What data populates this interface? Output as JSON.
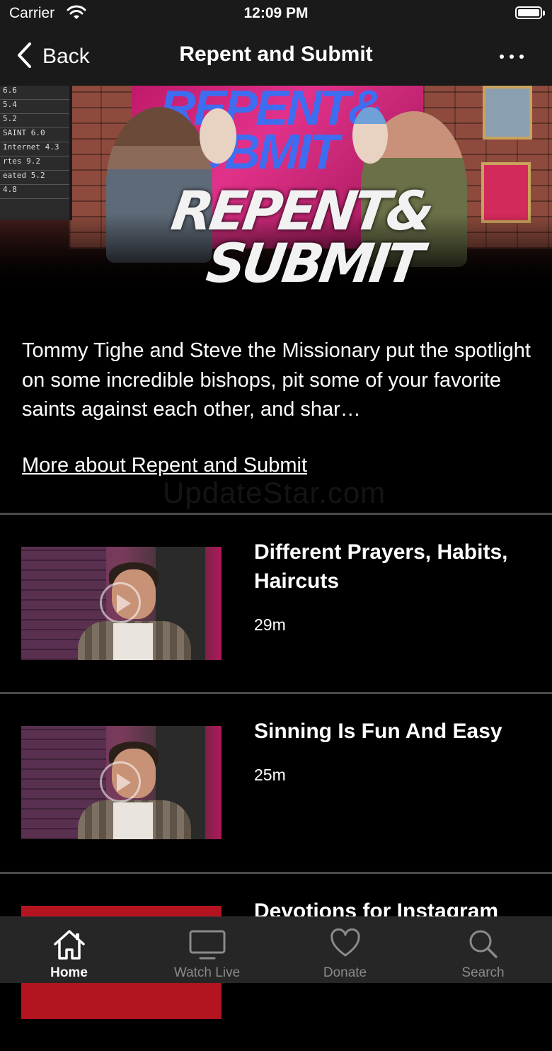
{
  "status_bar": {
    "carrier": "Carrier",
    "time": "12:09 PM"
  },
  "nav": {
    "back_label": "Back",
    "title": "Repent and Submit"
  },
  "hero": {
    "board_rows": [
      "6.6",
      "5.4",
      "5.2",
      "SAINT 6.0",
      "Internet 4.3",
      "rtes 9.2",
      "eated 5.2",
      "4.8"
    ],
    "screen_text_line1": "REPENT&",
    "screen_text_line2": "SUBMIT",
    "logo_line1": "REPENT&",
    "logo_line2": "SUBMIT"
  },
  "description": "Tommy Tighe and Steve the Missionary put the spotlight on some incredible bishops, pit some of your favorite saints against each other, and shar…",
  "more_link": "More about Repent and Submit",
  "watermark": "UpdateStar.com",
  "episodes": [
    {
      "title": "Different Prayers, Habits, Haircuts",
      "duration": "29m"
    },
    {
      "title": "Sinning Is Fun And Easy",
      "duration": "25m"
    },
    {
      "title": "Devotions for Instagram",
      "duration": ""
    }
  ],
  "tabs": [
    {
      "label": "Home",
      "icon": "home-icon",
      "active": true
    },
    {
      "label": "Watch Live",
      "icon": "tv-icon",
      "active": false
    },
    {
      "label": "Donate",
      "icon": "heart-icon",
      "active": false
    },
    {
      "label": "Search",
      "icon": "search-icon",
      "active": false
    }
  ],
  "colors": {
    "background": "#000000",
    "bar": "#1a1a1a",
    "tabbar": "#262626",
    "divider": "#4a4a4a",
    "inactive_tab": "#8a8a8a"
  }
}
